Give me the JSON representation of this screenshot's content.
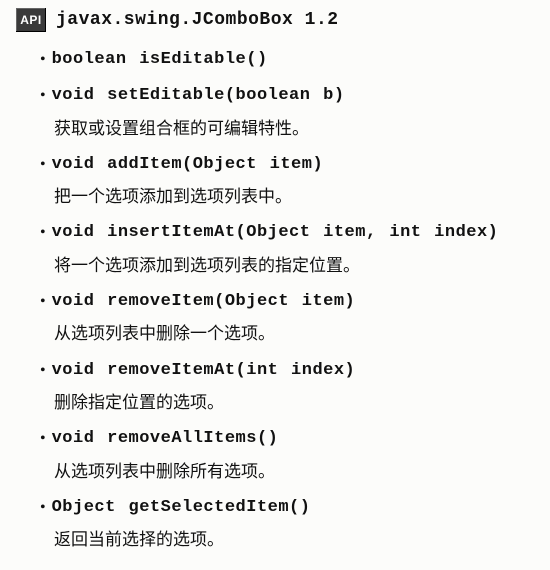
{
  "header": {
    "badge": "API",
    "class_name": "javax.swing.JComboBox 1.2"
  },
  "entries": [
    {
      "sig": "boolean isEditable()",
      "desc": null
    },
    {
      "sig": "void setEditable(boolean b)",
      "desc": "获取或设置组合框的可编辑特性。"
    },
    {
      "sig": "void addItem(Object item)",
      "desc": "把一个选项添加到选项列表中。"
    },
    {
      "sig": "void insertItemAt(Object item, int index)",
      "desc": "将一个选项添加到选项列表的指定位置。"
    },
    {
      "sig": "void removeItem(Object item)",
      "desc": "从选项列表中删除一个选项。"
    },
    {
      "sig": "void removeItemAt(int index)",
      "desc": "删除指定位置的选项。"
    },
    {
      "sig": "void removeAllItems()",
      "desc": "从选项列表中删除所有选项。"
    },
    {
      "sig": "Object getSelectedItem()",
      "desc": "返回当前选择的选项。"
    }
  ]
}
